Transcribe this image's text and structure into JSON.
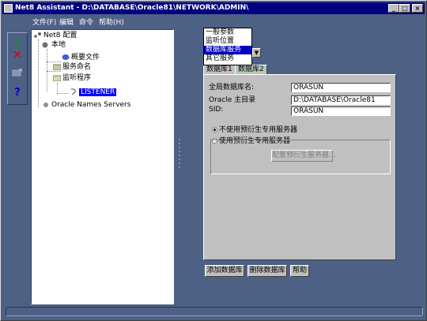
{
  "window": {
    "title": "Net8 Assistant - D:\\DATABASE\\Oracle81\\NETWORK\\ADMIN\\"
  },
  "title_buttons": {
    "minimize": "_",
    "maximize": "□",
    "close": "×"
  },
  "menu": [
    "文件(F)",
    "编辑",
    "命令",
    "帮助(H)"
  ],
  "toolbar": {
    "add": "+",
    "remove": "×",
    "help": "?"
  },
  "tree": {
    "root": "Net8 配置",
    "local": "本地",
    "profile": "概要文件",
    "service_naming": "服务命名",
    "listeners": "监听程序",
    "listener": "LISTENER",
    "names_servers": "Oracle Names Servers"
  },
  "dropdown": {
    "options": [
      "一般参数",
      "监听位置",
      "数据库服务",
      "其它服务"
    ],
    "highlighted_index": 2
  },
  "tabs": [
    "数据库1",
    "数据库2"
  ],
  "form": {
    "global_db_name_label": "全局数据库名:",
    "global_db_name_value": "ORASUN",
    "oracle_home_label": "Oracle 主目录",
    "oracle_home_value": "D:\\DATABASE\\Oracle81",
    "sid_label": "SID:",
    "sid_value": "ORASUN",
    "radio_no_prespawn": "不使用预衍生专用服务器",
    "radio_use_prespawn": "使用预衍生专用服务器",
    "config_prespawn_button": "配置预衍生服务器..."
  },
  "buttons": {
    "add_database": "添加数据库",
    "remove_database": "删除数据库",
    "help": "帮助"
  },
  "colors": {
    "background": "#4d6185",
    "titlebar": "#000080",
    "selection": "#0000ff",
    "add_icon": "#00a000",
    "remove_icon": "#e00000",
    "help_icon": "#0000c0"
  }
}
